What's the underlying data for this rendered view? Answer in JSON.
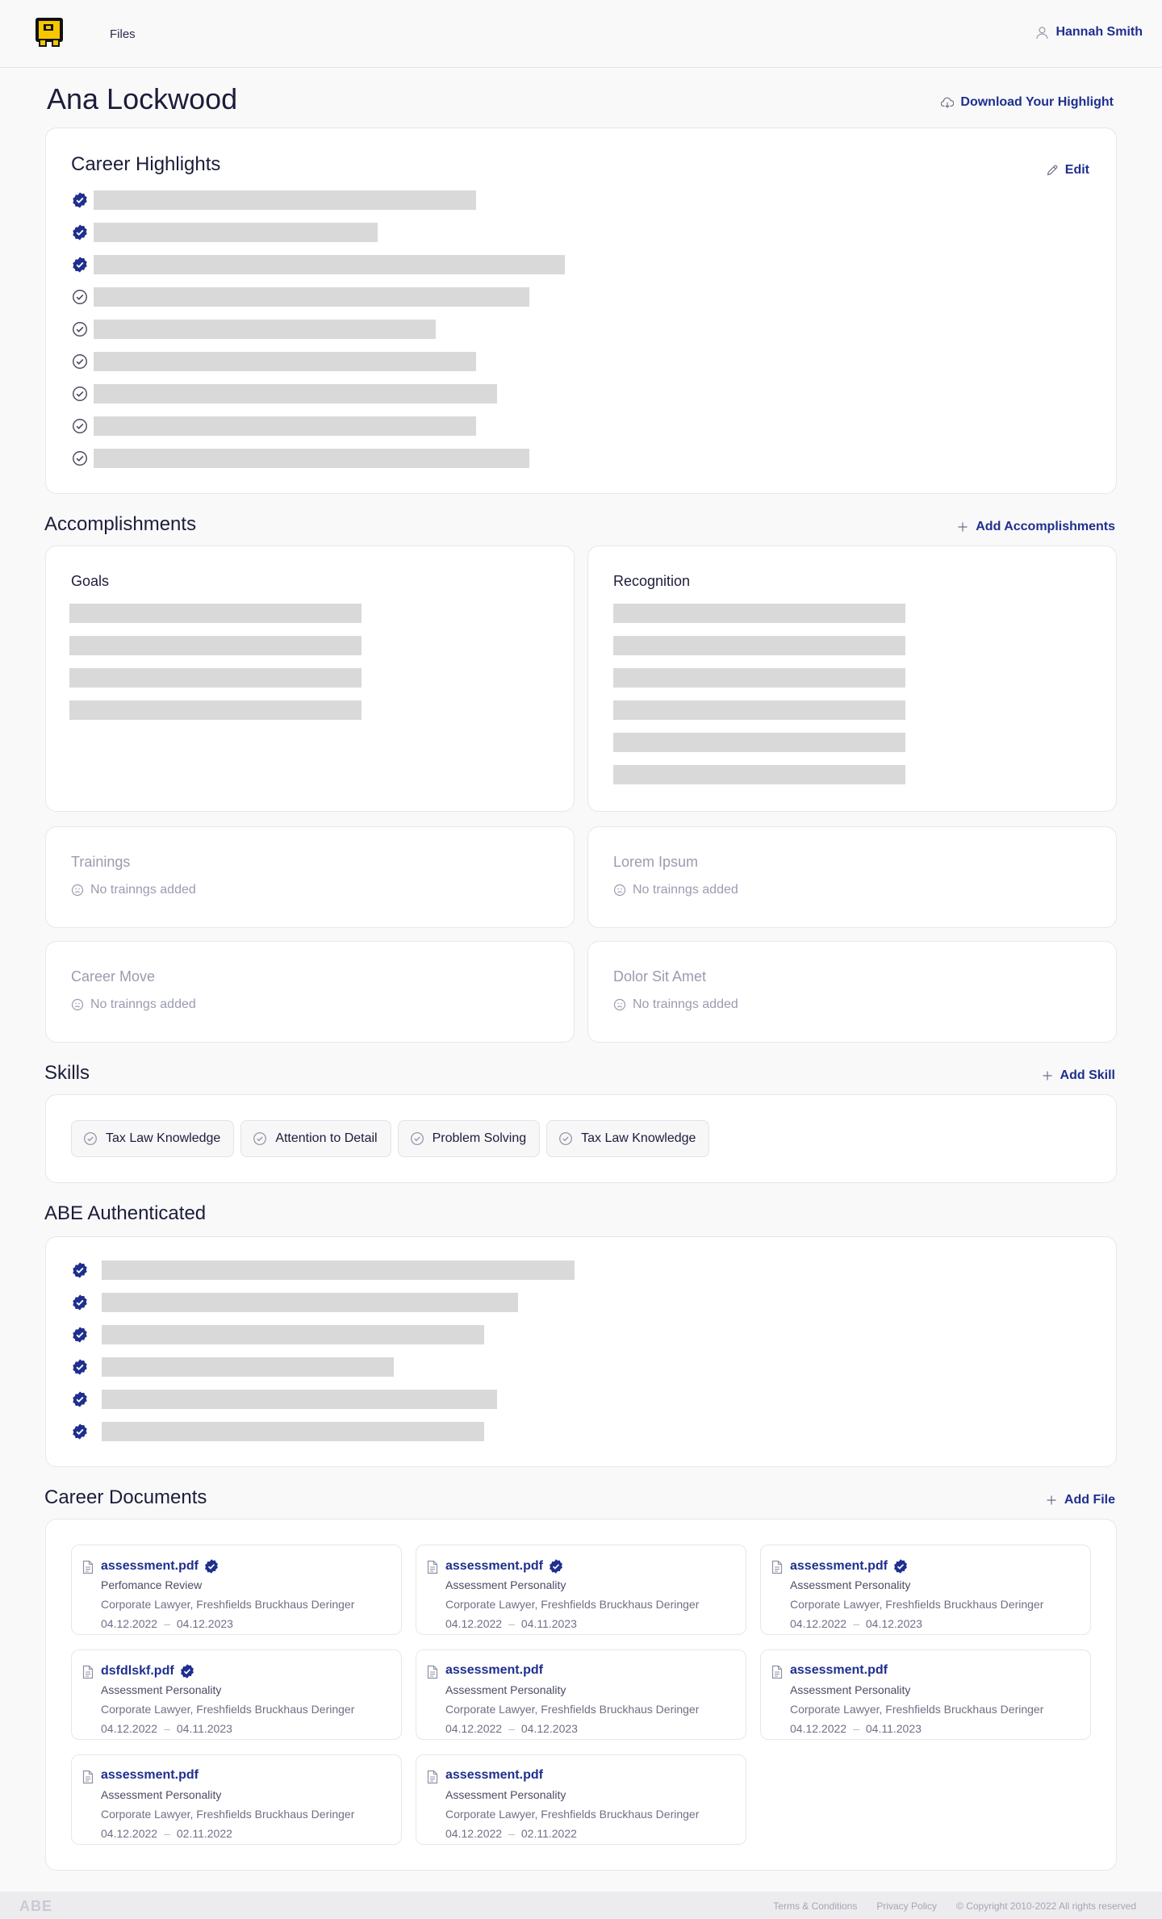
{
  "header": {
    "nav_files": "Files",
    "user_name": "Hannah Smith"
  },
  "profile": {
    "name": "Ana Lockwood",
    "download_label": "Download Your Highlight"
  },
  "career_highlights": {
    "title": "Career Highlights",
    "edit_label": "Edit",
    "items": [
      {
        "verified": true
      },
      {
        "verified": true
      },
      {
        "verified": true
      },
      {
        "verified": false
      },
      {
        "verified": false
      },
      {
        "verified": false
      },
      {
        "verified": false
      },
      {
        "verified": false
      },
      {
        "verified": false
      }
    ]
  },
  "accomplishments": {
    "title": "Accomplishments",
    "add_label": "Add Accomplishments",
    "goals_title": "Goals",
    "recognition_title": "Recognition",
    "empty_cards": [
      {
        "title": "Trainings",
        "empty_text": "No trainngs added"
      },
      {
        "title": "Lorem Ipsum",
        "empty_text": "No trainngs added"
      },
      {
        "title": "Career Move",
        "empty_text": "No trainngs added"
      },
      {
        "title": "Dolor Sit Amet",
        "empty_text": "No trainngs added"
      }
    ]
  },
  "skills": {
    "title": "Skills",
    "add_label": "Add Skill",
    "items": [
      "Tax Law Knowledge",
      "Attention to Detail",
      "Problem Solving",
      "Tax Law Knowledge"
    ]
  },
  "abe_authenticated": {
    "title": "ABE Authenticated"
  },
  "career_documents": {
    "title": "Career Documents",
    "add_label": "Add File",
    "files": [
      {
        "name": "assessment.pdf",
        "verified": true,
        "type": "Perfomance Review",
        "org": "Corporate Lawyer, Freshfields Bruckhaus Deringer",
        "start": "04.12.2022",
        "end": "04.12.2023"
      },
      {
        "name": "assessment.pdf",
        "verified": true,
        "type": "Assessment Personality",
        "org": "Corporate Lawyer, Freshfields Bruckhaus Deringer",
        "start": "04.12.2022",
        "end": "04.11.2023"
      },
      {
        "name": "assessment.pdf",
        "verified": true,
        "type": "Assessment Personality",
        "org": "Corporate Lawyer, Freshfields Bruckhaus Deringer",
        "start": "04.12.2022",
        "end": "04.12.2023"
      },
      {
        "name": "dsfdlskf.pdf",
        "verified": true,
        "type": "Assessment Personality",
        "org": "Corporate Lawyer, Freshfields Bruckhaus Deringer",
        "start": "04.12.2022",
        "end": "04.11.2023"
      },
      {
        "name": "assessment.pdf",
        "verified": false,
        "type": "Assessment Personality",
        "org": "Corporate Lawyer, Freshfields Bruckhaus Deringer",
        "start": "04.12.2022",
        "end": "04.12.2023"
      },
      {
        "name": "assessment.pdf",
        "verified": false,
        "type": "Assessment Personality",
        "org": "Corporate Lawyer, Freshfields Bruckhaus Deringer",
        "start": "04.12.2022",
        "end": "04.11.2023"
      },
      {
        "name": "assessment.pdf",
        "verified": false,
        "type": "Assessment Personality",
        "org": "Corporate Lawyer, Freshfields Bruckhaus Deringer",
        "start": "04.12.2022",
        "end": "02.11.2022"
      },
      {
        "name": "assessment.pdf",
        "verified": false,
        "type": "Assessment Personality",
        "org": "Corporate Lawyer, Freshfields Bruckhaus Deringer",
        "start": "04.12.2022",
        "end": "02.11.2022"
      }
    ]
  },
  "footer": {
    "logo": "ABE",
    "terms": "Terms & Conditions",
    "privacy": "Privacy Policy",
    "copyright": "© Copyright 2010-2022 All rights reserved"
  },
  "colors": {
    "accent": "#1e2f8e",
    "logo_yellow": "#f6c700",
    "placeholder": "#d9d9d9"
  },
  "icons": [
    "logo-icon",
    "user-icon",
    "download-icon",
    "edit-icon",
    "verified-badge-icon",
    "check-circle-icon",
    "plus-icon",
    "sad-face-icon",
    "file-icon"
  ]
}
